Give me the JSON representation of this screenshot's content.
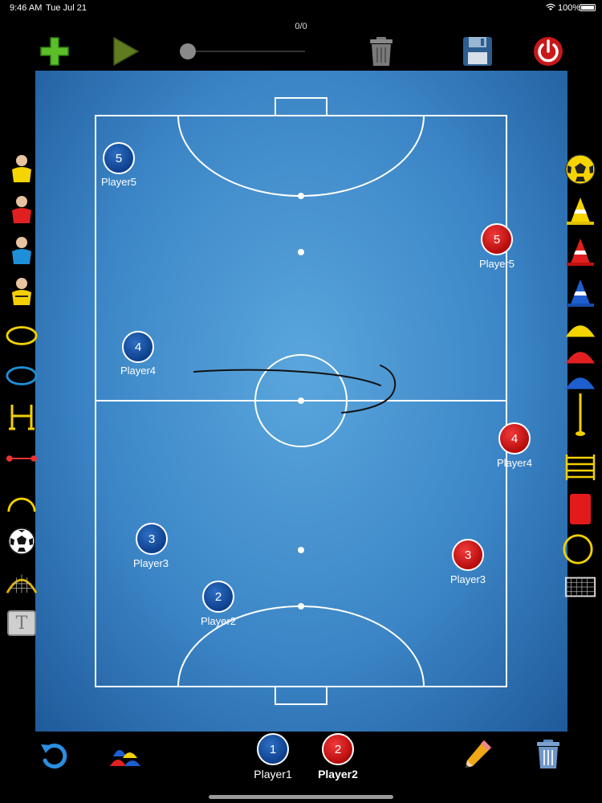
{
  "status_bar": {
    "time": "9:46 AM",
    "date": "Tue Jul 21",
    "battery": "100%"
  },
  "toolbar": {
    "counter": "0/0",
    "icons": [
      "plus-icon",
      "play-icon",
      "trash-icon",
      "save-icon",
      "power-icon"
    ]
  },
  "pitch": {
    "blue_team": [
      {
        "number": "5",
        "label": "Player5"
      },
      {
        "number": "4",
        "label": "Player4"
      },
      {
        "number": "3",
        "label": "Player3"
      },
      {
        "number": "2",
        "label": "Player2"
      }
    ],
    "red_team": [
      {
        "number": "5",
        "label": "Player5"
      },
      {
        "number": "4",
        "label": "Player4"
      },
      {
        "number": "3",
        "label": "Player3"
      }
    ]
  },
  "left_palette": [
    "player-yellow-icon",
    "player-red-icon",
    "player-blue-icon",
    "referee-icon",
    "yellow-ring-icon",
    "blue-ring-icon",
    "hurdle-icon",
    "rope-icon",
    "arc-icon",
    "soccer-ball-icon",
    "goal-net-icon",
    "text-tool-icon"
  ],
  "left_text_tool": "T",
  "right_palette": [
    "yellow-ball-icon",
    "yellow-cone-icon",
    "red-cone-icon",
    "blue-cone-icon",
    "yellow-disc-icon",
    "red-disc-icon",
    "blue-disc-icon",
    "pole-icon",
    "ladder-icon",
    "red-card-icon",
    "yellow-ring-icon",
    "mini-goal-icon"
  ],
  "bottom_bar": {
    "player1": {
      "number": "1",
      "label": "Player1"
    },
    "player2": {
      "number": "2",
      "label": "Player2"
    }
  },
  "colors": {
    "blue_team": "#0d3f8c",
    "red_team": "#c00f0f",
    "pitch": "#3c86c7",
    "accent_green": "#4caf2a"
  }
}
